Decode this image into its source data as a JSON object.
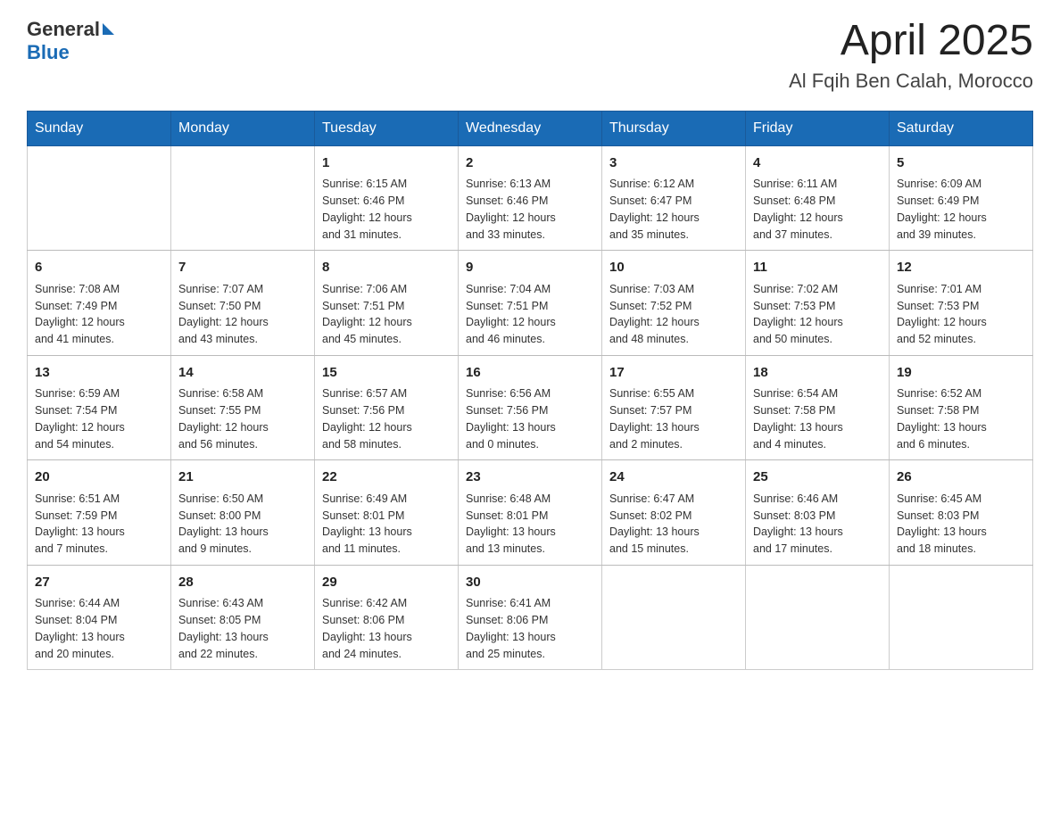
{
  "logo": {
    "general": "General",
    "blue": "Blue"
  },
  "title": {
    "month": "April 2025",
    "location": "Al Fqih Ben Calah, Morocco"
  },
  "weekdays": [
    "Sunday",
    "Monday",
    "Tuesday",
    "Wednesday",
    "Thursday",
    "Friday",
    "Saturday"
  ],
  "weeks": [
    [
      {
        "day": "",
        "info": ""
      },
      {
        "day": "",
        "info": ""
      },
      {
        "day": "1",
        "info": "Sunrise: 6:15 AM\nSunset: 6:46 PM\nDaylight: 12 hours\nand 31 minutes."
      },
      {
        "day": "2",
        "info": "Sunrise: 6:13 AM\nSunset: 6:46 PM\nDaylight: 12 hours\nand 33 minutes."
      },
      {
        "day": "3",
        "info": "Sunrise: 6:12 AM\nSunset: 6:47 PM\nDaylight: 12 hours\nand 35 minutes."
      },
      {
        "day": "4",
        "info": "Sunrise: 6:11 AM\nSunset: 6:48 PM\nDaylight: 12 hours\nand 37 minutes."
      },
      {
        "day": "5",
        "info": "Sunrise: 6:09 AM\nSunset: 6:49 PM\nDaylight: 12 hours\nand 39 minutes."
      }
    ],
    [
      {
        "day": "6",
        "info": "Sunrise: 7:08 AM\nSunset: 7:49 PM\nDaylight: 12 hours\nand 41 minutes."
      },
      {
        "day": "7",
        "info": "Sunrise: 7:07 AM\nSunset: 7:50 PM\nDaylight: 12 hours\nand 43 minutes."
      },
      {
        "day": "8",
        "info": "Sunrise: 7:06 AM\nSunset: 7:51 PM\nDaylight: 12 hours\nand 45 minutes."
      },
      {
        "day": "9",
        "info": "Sunrise: 7:04 AM\nSunset: 7:51 PM\nDaylight: 12 hours\nand 46 minutes."
      },
      {
        "day": "10",
        "info": "Sunrise: 7:03 AM\nSunset: 7:52 PM\nDaylight: 12 hours\nand 48 minutes."
      },
      {
        "day": "11",
        "info": "Sunrise: 7:02 AM\nSunset: 7:53 PM\nDaylight: 12 hours\nand 50 minutes."
      },
      {
        "day": "12",
        "info": "Sunrise: 7:01 AM\nSunset: 7:53 PM\nDaylight: 12 hours\nand 52 minutes."
      }
    ],
    [
      {
        "day": "13",
        "info": "Sunrise: 6:59 AM\nSunset: 7:54 PM\nDaylight: 12 hours\nand 54 minutes."
      },
      {
        "day": "14",
        "info": "Sunrise: 6:58 AM\nSunset: 7:55 PM\nDaylight: 12 hours\nand 56 minutes."
      },
      {
        "day": "15",
        "info": "Sunrise: 6:57 AM\nSunset: 7:56 PM\nDaylight: 12 hours\nand 58 minutes."
      },
      {
        "day": "16",
        "info": "Sunrise: 6:56 AM\nSunset: 7:56 PM\nDaylight: 13 hours\nand 0 minutes."
      },
      {
        "day": "17",
        "info": "Sunrise: 6:55 AM\nSunset: 7:57 PM\nDaylight: 13 hours\nand 2 minutes."
      },
      {
        "day": "18",
        "info": "Sunrise: 6:54 AM\nSunset: 7:58 PM\nDaylight: 13 hours\nand 4 minutes."
      },
      {
        "day": "19",
        "info": "Sunrise: 6:52 AM\nSunset: 7:58 PM\nDaylight: 13 hours\nand 6 minutes."
      }
    ],
    [
      {
        "day": "20",
        "info": "Sunrise: 6:51 AM\nSunset: 7:59 PM\nDaylight: 13 hours\nand 7 minutes."
      },
      {
        "day": "21",
        "info": "Sunrise: 6:50 AM\nSunset: 8:00 PM\nDaylight: 13 hours\nand 9 minutes."
      },
      {
        "day": "22",
        "info": "Sunrise: 6:49 AM\nSunset: 8:01 PM\nDaylight: 13 hours\nand 11 minutes."
      },
      {
        "day": "23",
        "info": "Sunrise: 6:48 AM\nSunset: 8:01 PM\nDaylight: 13 hours\nand 13 minutes."
      },
      {
        "day": "24",
        "info": "Sunrise: 6:47 AM\nSunset: 8:02 PM\nDaylight: 13 hours\nand 15 minutes."
      },
      {
        "day": "25",
        "info": "Sunrise: 6:46 AM\nSunset: 8:03 PM\nDaylight: 13 hours\nand 17 minutes."
      },
      {
        "day": "26",
        "info": "Sunrise: 6:45 AM\nSunset: 8:03 PM\nDaylight: 13 hours\nand 18 minutes."
      }
    ],
    [
      {
        "day": "27",
        "info": "Sunrise: 6:44 AM\nSunset: 8:04 PM\nDaylight: 13 hours\nand 20 minutes."
      },
      {
        "day": "28",
        "info": "Sunrise: 6:43 AM\nSunset: 8:05 PM\nDaylight: 13 hours\nand 22 minutes."
      },
      {
        "day": "29",
        "info": "Sunrise: 6:42 AM\nSunset: 8:06 PM\nDaylight: 13 hours\nand 24 minutes."
      },
      {
        "day": "30",
        "info": "Sunrise: 6:41 AM\nSunset: 8:06 PM\nDaylight: 13 hours\nand 25 minutes."
      },
      {
        "day": "",
        "info": ""
      },
      {
        "day": "",
        "info": ""
      },
      {
        "day": "",
        "info": ""
      }
    ]
  ]
}
